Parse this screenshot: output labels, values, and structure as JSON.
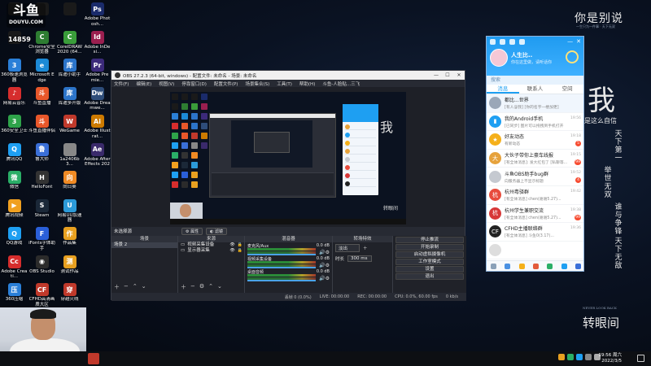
{
  "douyu": {
    "logo": "斗鱼",
    "domain": "DOUYU.COM",
    "room_id": "14859"
  },
  "desktop_icons": [
    {
      "label": "",
      "color": "#1a1a1a",
      "glyph": ""
    },
    {
      "label": "",
      "color": "#1a1a1a",
      "glyph": ""
    },
    {
      "label": "",
      "color": "#1a1a1a",
      "glyph": ""
    },
    {
      "label": "Adobe Photosh...",
      "color": "#1a2b6b",
      "glyph": "Ps"
    },
    {
      "label": "",
      "color": "#1a1a1a",
      "glyph": ""
    },
    {
      "label": "Chrome安全浏览器",
      "color": "#2e7d32",
      "glyph": "C"
    },
    {
      "label": "CorelDRAW 2020 (64...",
      "color": "#3a9d3a",
      "glyph": "C"
    },
    {
      "label": "Adobe InDesi...",
      "color": "#9b1f4f",
      "glyph": "Id"
    },
    {
      "label": "360极速浏览器",
      "color": "#2a7fd8",
      "glyph": "3"
    },
    {
      "label": "Microsoft Edge",
      "color": "#1c8ad6",
      "glyph": "e"
    },
    {
      "label": "库迪小助手",
      "color": "#2c74c9",
      "glyph": "库"
    },
    {
      "label": "Adobe Premie...",
      "color": "#3c2a7a",
      "glyph": "Pr"
    },
    {
      "label": "网易云音乐",
      "color": "#d62d2d",
      "glyph": "♪"
    },
    {
      "label": "斗鱼直播",
      "color": "#e8572a",
      "glyph": "斗"
    },
    {
      "label": "库迪多开版",
      "color": "#2c74c9",
      "glyph": "库"
    },
    {
      "label": "Adobe Dreamwe...",
      "color": "#2e4d7a",
      "glyph": "Dw"
    },
    {
      "label": "360安全卫士",
      "color": "#2ea34a",
      "glyph": "3"
    },
    {
      "label": "斗鱼直播伴侣",
      "color": "#e8572a",
      "glyph": "斗"
    },
    {
      "label": "WeGame",
      "color": "#c0392b",
      "glyph": "W"
    },
    {
      "label": "Adobe Illustrat...",
      "color": "#cc7a00",
      "glyph": "Ai"
    },
    {
      "label": "腾讯QQ",
      "color": "#1e9ff2",
      "glyph": "Q"
    },
    {
      "label": "鲁大师",
      "color": "#3a6fd8",
      "glyph": "鲁"
    },
    {
      "label": "1a2406b3...",
      "color": "#888888",
      "glyph": ""
    },
    {
      "label": "Adobe After Effects 2020",
      "color": "#3a2a6b",
      "glyph": "Ae"
    },
    {
      "label": "微信",
      "color": "#2aae67",
      "glyph": "微"
    },
    {
      "label": "HelloFont",
      "color": "#333333",
      "glyph": "H"
    },
    {
      "label": "向日葵",
      "color": "#f08a24",
      "glyph": "向"
    },
    {
      "label": "",
      "color": "transparent",
      "glyph": ""
    },
    {
      "label": "腾讯视频",
      "color": "#f0a020",
      "glyph": "▶"
    },
    {
      "label": "Steam",
      "color": "#1b2838",
      "glyph": "S"
    },
    {
      "label": "网易UU加速器",
      "color": "#2c9ad8",
      "glyph": "U"
    },
    {
      "label": "",
      "color": "transparent",
      "glyph": ""
    },
    {
      "label": "QQ游戏",
      "color": "#1e9ff2",
      "glyph": "Q"
    },
    {
      "label": "iFonts字体助手",
      "color": "#2a5fd8",
      "glyph": "F"
    },
    {
      "label": "作品集",
      "color": "#e8a020",
      "glyph": "作"
    },
    {
      "label": "",
      "color": "transparent",
      "glyph": ""
    },
    {
      "label": "Adobe Creati...",
      "color": "#d62d2d",
      "glyph": "Cc"
    },
    {
      "label": "OBS Studio",
      "color": "#2b2b2b",
      "glyph": "◉"
    },
    {
      "label": "测试作品",
      "color": "#e8a020",
      "glyph": "测"
    },
    {
      "label": "",
      "color": "transparent",
      "glyph": ""
    },
    {
      "label": "360压缩",
      "color": "#2a7fd8",
      "glyph": "压"
    },
    {
      "label": "CFHD高清画质大区",
      "color": "#c0392b",
      "glyph": "CF"
    },
    {
      "label": "穿越火线",
      "color": "#c0392b",
      "glyph": "穿"
    },
    {
      "label": "",
      "color": "transparent",
      "glyph": ""
    }
  ],
  "calligraphy": {
    "top": "你是别说",
    "top_sub": "一生只为一件事 · 天下无双",
    "wo": "我",
    "line": "是这么自信",
    "col1": "天下第一",
    "col2": "举世无双",
    "col3": "谁与争锋",
    "col4": "天下无敌",
    "bottom_sub": "NEVER LOOK BACK",
    "bottom": "转眼间"
  },
  "obs": {
    "title": "OBS 27.2.3 (64-bit, windows) - 配置文件: 未命名 - 场景: 未命名",
    "menu": [
      "文件(F)",
      "编辑(E)",
      "视图(V)",
      "停靠窗口(D)",
      "配置文件(P)",
      "场景集合(S)",
      "工具(T)",
      "帮助(H)",
      "斗鱼-人脸贴...三飞"
    ],
    "no_source": "未选择源",
    "props_btn": "⚙ 属性",
    "filter_btn": "◐ 滤镜",
    "scenes_header": "场景",
    "scenes": [
      "场景 2"
    ],
    "sources_header": "来源",
    "sources": [
      "视频采集设备",
      "显示器采集"
    ],
    "mixer_header": "混音器",
    "mixer": [
      {
        "name": "麦克风/Aux",
        "level": "0.0 dB"
      },
      {
        "name": "视频采集设备",
        "level": "0.0 dB"
      },
      {
        "name": "桌面音频",
        "level": "0.0 dB"
      }
    ],
    "transitions_header": "转场特效",
    "transition_type": "淡出",
    "duration_label": "时长",
    "duration_value": "300 ms",
    "controls_header": "控件",
    "controls": [
      "停止推流",
      "开始录制",
      "启动虚拟摄像机",
      "工作室模式",
      "设置",
      "退出"
    ],
    "status": {
      "dropped": "丢帧 0 (0.0%)",
      "live": "LIVE: 00:00:00",
      "rec": "REC: 00:00:00",
      "cpu": "CPU: 0.0%, 60.00 fps",
      "kbps": "0 kb/s"
    }
  },
  "qq": {
    "username": "人生比..",
    "signature": "你在这里做，请听话你",
    "search_placeholder": "搜索",
    "tabs": [
      "消息",
      "联系人",
      "空间"
    ],
    "active_tab": 0,
    "conversations": [
      {
        "title": "都比...世界",
        "msg": "[有人@我] [你的名字一楼加更]",
        "time": "",
        "badge": "",
        "color": "#9aa7b8",
        "glyph": ""
      },
      {
        "title": "我的Android手机",
        "msg": "[已同步] 图片可以拖拽到手机打开",
        "time": "19:56",
        "badge": "",
        "color": "#1e9ff2",
        "glyph": "▮"
      },
      {
        "title": "好友动态",
        "msg": "有新动态",
        "time": "19:18",
        "badge": "5",
        "color": "#f5b01a",
        "glyph": "★"
      },
      {
        "title": "大伙子带你上豪车线报",
        "msg": "[有全体消息]: 发大红包了 [私聊等...",
        "time": "19:15",
        "badge": "99",
        "color": "#e6a23c",
        "glyph": "大"
      },
      {
        "title": "斗鱼OBS助手bug群",
        "msg": "向服务器上不显示标题",
        "time": "19:52",
        "badge": "4",
        "color": "#c5c9d0",
        "glyph": ""
      },
      {
        "title": "杭州粤驿群",
        "msg": "[有全体消息] chen(谢谢5.27)...",
        "time": "19:42",
        "badge": "",
        "color": "#e84c3d",
        "glyph": "杭"
      },
      {
        "title": "杭州学生兼职交流",
        "msg": "[有全体消息] chen(谢谢5.27)...",
        "time": "19:38",
        "badge": "99",
        "color": "#d73838",
        "glyph": "杭"
      },
      {
        "title": "CFHD主播联络群",
        "msg": "[有全体消息] 斗鱼0(3.17)...",
        "time": "19:36",
        "badge": "",
        "color": "#222222",
        "glyph": "CF"
      },
      {
        "title": "",
        "msg": "",
        "time": "",
        "badge": "",
        "color": "#dddddd",
        "glyph": ""
      }
    ]
  },
  "taskbar": {
    "time": "19:56 周六",
    "date": "2022/3/5"
  }
}
